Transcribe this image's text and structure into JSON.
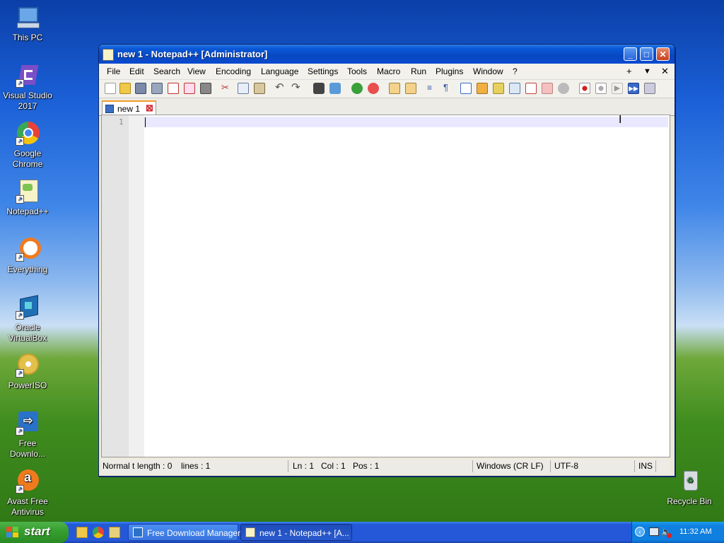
{
  "desktop": {
    "icons": [
      {
        "label": "This PC",
        "icon": "computer-icon",
        "color": "#6aa7e8"
      },
      {
        "label": "Visual Studio 2017",
        "icon": "visual-studio-icon",
        "color": "#7a4ec7"
      },
      {
        "label": "Google Chrome",
        "icon": "chrome-icon",
        "color": "#e8423a"
      },
      {
        "label": "Notepad++",
        "icon": "notepadpp-icon",
        "color": "#7ec452"
      },
      {
        "label": "Everything",
        "icon": "everything-icon",
        "color": "#f07a1e"
      },
      {
        "label": "Oracle VirtualBox",
        "icon": "virtualbox-icon",
        "color": "#1f6fb4"
      },
      {
        "label": "PowerISO",
        "icon": "poweriso-icon",
        "color": "#e3c04a"
      },
      {
        "label": "Free Downlo...",
        "icon": "free-download-manager-icon",
        "color": "#2a72c9"
      },
      {
        "label": "Avast Free Antivirus",
        "icon": "avast-icon",
        "color": "#f07a1e"
      },
      {
        "label": "Recycle Bin",
        "icon": "recycle-bin-icon",
        "color": "#d8dde2"
      }
    ]
  },
  "window": {
    "title": "new 1 - Notepad++ [Administrator]",
    "menu": [
      "File",
      "Edit",
      "Search",
      "View",
      "Encoding",
      "Language",
      "Settings",
      "Tools",
      "Macro",
      "Run",
      "Plugins",
      "Window",
      "?"
    ],
    "menu_right": {
      "add": "+",
      "dropdown": "▼",
      "close": "✕"
    },
    "tab": {
      "label": "new 1",
      "close": "⊠"
    },
    "editor": {
      "line_number": "1",
      "content": ""
    },
    "status": {
      "language": "Normal t",
      "length": "length : 0",
      "lines": "lines : 1",
      "ln": "Ln : 1",
      "col": "Col : 1",
      "pos": "Pos : 1",
      "eol": "Windows (CR LF)",
      "encoding": "UTF-8",
      "mode": "INS"
    }
  },
  "taskbar": {
    "start_label": "start",
    "tasks": [
      {
        "label": "Free Download Manager",
        "icon": "free-download-manager-icon"
      },
      {
        "label": "new 1 - Notepad++ [A...",
        "icon": "notepadpp-icon",
        "active": true
      }
    ],
    "clock": "11:32 AM"
  }
}
